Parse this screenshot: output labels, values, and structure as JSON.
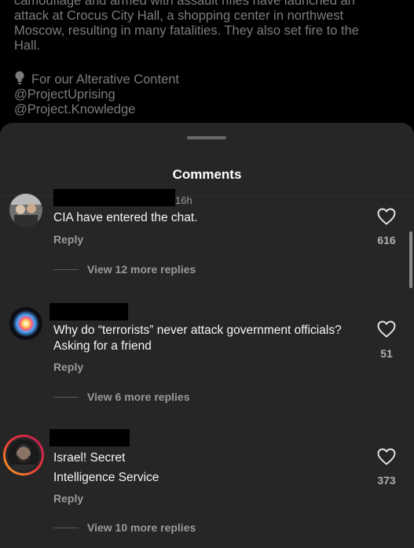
{
  "caption": {
    "line1": "camouflage and armed with assault rifles have launched an",
    "line2": "attack at Crocus City Hall, a shopping center in northwest",
    "line3": "Moscow, resulting in many fatalities. They also set fire to the",
    "line4": "Hall.",
    "alt_label": "For our Alterative Content",
    "handle1": "@ProjectUprising",
    "handle2": "@Project.Knowledge"
  },
  "sheet": {
    "title": "Comments"
  },
  "comments": [
    {
      "time": "16h",
      "text": "CIA have entered the chat.",
      "reply_label": "Reply",
      "likes": "616",
      "more_replies": "View 12 more replies"
    },
    {
      "time": "",
      "text": "Why do “terrorists” never attack government officials? Asking for a friend",
      "reply_label": "Reply",
      "likes": "51",
      "more_replies": "View 6 more replies"
    },
    {
      "time": "",
      "text_line1": "Israel! Secret",
      "text_line2": "Intelligence Service",
      "reply_label": "Reply",
      "likes": "373",
      "more_replies": "View 10 more replies"
    }
  ],
  "colors": {
    "sheet_bg": "#262626",
    "text_primary": "#f5f5f5",
    "text_secondary": "#9a9a9a",
    "story_ring_start": "#f9a825",
    "story_ring_end": "#c2185b"
  }
}
